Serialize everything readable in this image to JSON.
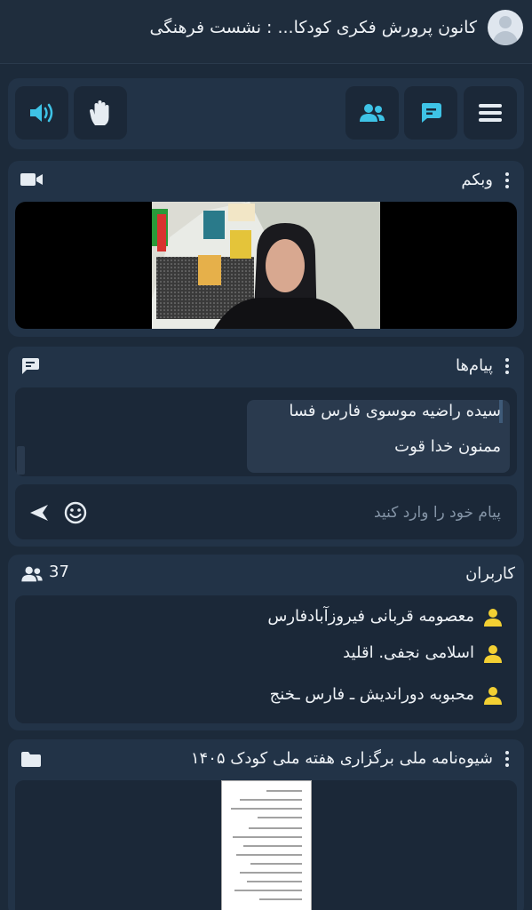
{
  "header": {
    "title": "کانون پرورش فکری کودکا... : نشست فرهنگی",
    "avatar_icon": "user-avatar-icon"
  },
  "toolbar": {
    "buttons": [
      {
        "name": "menu",
        "icon": "hamburger-icon"
      },
      {
        "name": "chat",
        "icon": "chat-icon"
      },
      {
        "name": "users",
        "icon": "users-icon"
      },
      {
        "name": "raise-hand",
        "icon": "hand-icon"
      },
      {
        "name": "speaker",
        "icon": "speaker-icon"
      }
    ],
    "accent_color": "#3ec3e6"
  },
  "webcam": {
    "title": "وبکم",
    "icon": "video-camera-icon"
  },
  "messages": {
    "title": "پیام‌ها",
    "icon": "message-icon",
    "sender_line": "سیده راضیه موسوی فارس فسا",
    "text_line": "ممنون خدا قوت",
    "input_placeholder": "پیام خود را وارد کنید",
    "emoji_icon": "smiley-icon",
    "send_icon": "send-icon"
  },
  "users": {
    "title": "کاربران",
    "count": "37",
    "icon": "users-icon",
    "user_color": "#f3d033",
    "list": [
      {
        "name": "معصومه قربانی فیروزآبادفارس"
      },
      {
        "name": "اسلامی نجفی. اقلید"
      },
      {
        "name": "محبوبه دوراندیش ـ فارس ـخنج"
      }
    ]
  },
  "document": {
    "title": "شیوه‌نامه ملی برگزاری هفته ملی کودک ۱۴۰۵",
    "icon": "folder-icon"
  }
}
